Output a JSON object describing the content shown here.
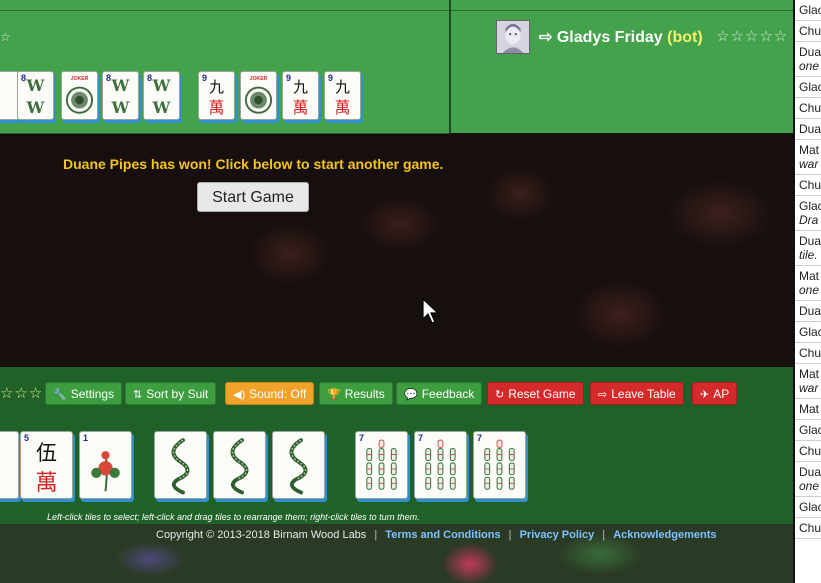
{
  "opponent": {
    "name": "Gladys Friday",
    "bot_label": "(bot)",
    "rating_stars": "☆☆☆☆☆"
  },
  "top_meld_tiles": [
    {
      "kind": "wind",
      "index": "8",
      "letter_top": "W",
      "letter_bottom": "W"
    },
    {
      "kind": "joker",
      "index": "",
      "label": "JOKER"
    },
    {
      "kind": "wind",
      "index": "8",
      "letter_top": "W",
      "letter_bottom": "W"
    },
    {
      "kind": "wind",
      "index": "8",
      "letter_top": "W",
      "letter_bottom": "W"
    },
    {
      "kind": "character",
      "index": "9",
      "top": "九",
      "bottom": "萬"
    },
    {
      "kind": "joker",
      "index": "",
      "label": "JOKER"
    },
    {
      "kind": "character",
      "index": "9",
      "top": "九",
      "bottom": "萬"
    },
    {
      "kind": "character",
      "index": "9",
      "top": "九",
      "bottom": "萬"
    }
  ],
  "status": {
    "win_message": "Duane Pipes has won! Click below to start another game.",
    "start_button": "Start Game"
  },
  "toolbar": {
    "rating_stars": "☆☆☆",
    "settings": "Settings",
    "sort": "Sort by Suit",
    "sound": "Sound: Off",
    "results": "Results",
    "feedback": "Feedback",
    "reset": "Reset Game",
    "leave": "Leave Table",
    "ap": "AP"
  },
  "hand_tiles": [
    {
      "kind": "partial",
      "index": ""
    },
    {
      "kind": "character",
      "index": "5",
      "top": "伍",
      "bottom": "萬"
    },
    {
      "kind": "flower",
      "index": "1"
    },
    {
      "kind": "dragon",
      "index": ""
    },
    {
      "kind": "dragon",
      "index": ""
    },
    {
      "kind": "dragon",
      "index": ""
    },
    {
      "kind": "bamboo",
      "index": "7"
    },
    {
      "kind": "bamboo",
      "index": "7"
    },
    {
      "kind": "bamboo",
      "index": "7"
    }
  ],
  "hint": "Left-click tiles to select; left-click and drag tiles to rearrange them; right-click tiles to turn them.",
  "footer": {
    "copyright": "Copyright © 2013-2018 Birnam Wood Labs",
    "terms": "Terms and Conditions",
    "privacy": "Privacy Policy",
    "acknowledgements": "Acknowledgements"
  },
  "chat": [
    {
      "text": "Glac"
    },
    {
      "text": "Chu"
    },
    {
      "text": "Dua",
      "sub": "one"
    },
    {
      "text": "Glac"
    },
    {
      "text": "Chu"
    },
    {
      "text": "Dua"
    },
    {
      "text": "Mat",
      "sub": "war"
    },
    {
      "text": "Chu"
    },
    {
      "text": "Glac",
      "sub": "Dra"
    },
    {
      "text": "Dua",
      "sub": "tile."
    },
    {
      "text": "Mat",
      "sub": "one"
    },
    {
      "text": "Dua"
    },
    {
      "text": "Glac"
    },
    {
      "text": "Chu"
    },
    {
      "text": "Mat",
      "sub": "war"
    },
    {
      "text": "Mat"
    },
    {
      "text": "Glac"
    },
    {
      "text": "Chu"
    },
    {
      "text": "Dua",
      "sub": "one"
    },
    {
      "text": "Glac"
    },
    {
      "text": "Chu"
    }
  ]
}
